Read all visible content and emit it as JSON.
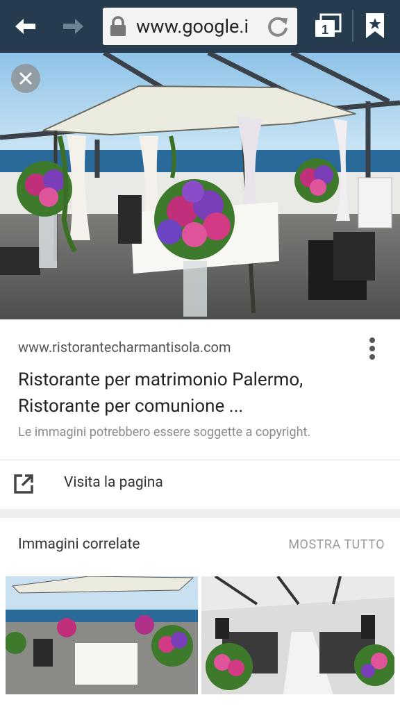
{
  "browser": {
    "url": "www.google.i",
    "tab_count": "1",
    "icons": {
      "back": "back-arrow-icon",
      "forward": "forward-arrow-icon",
      "lock": "lock-icon",
      "reload": "reload-icon",
      "tabs": "tabs-icon",
      "bookmark": "bookmark-star-icon"
    }
  },
  "viewer": {
    "close_icon": "close-icon"
  },
  "result": {
    "site": "www.ristorantecharmantisola.com",
    "title": "Ristorante per matrimonio Palermo, Ristorante per comunione ...",
    "copyright_note": "Le immagini potrebbero essere soggette a copyright.",
    "visit_label": "Visita la pagina"
  },
  "related": {
    "title": "Immagini correlate",
    "show_all": "MOSTRA TUTTO"
  },
  "colors": {
    "toolbar": "#263c4e",
    "sea": "#2a6a9a",
    "flowers": "#c0307a"
  }
}
